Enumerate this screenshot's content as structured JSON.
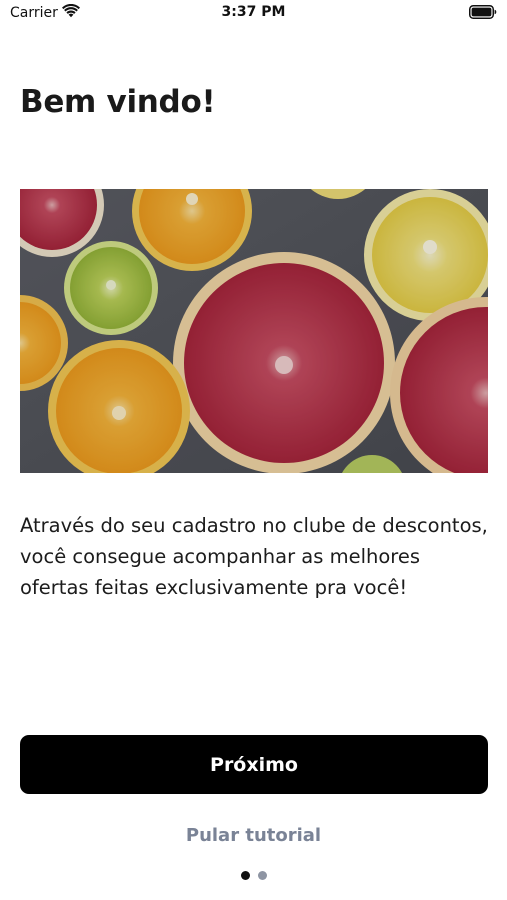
{
  "status_bar": {
    "carrier": "Carrier",
    "time": "3:37 PM",
    "icons": [
      "wifi-icon",
      "battery-icon"
    ]
  },
  "onboarding": {
    "title": "Bem vindo!",
    "image": "citrus-fruit-slices",
    "description": "Através do seu cadastro no clube de descontos, você consegue acompanhar as melhores ofertas feitas exclusivamente pra você!",
    "next_label": "Próximo",
    "skip_label": "Pular tutorial",
    "pages": {
      "total": 2,
      "current": 1
    }
  },
  "colors": {
    "button_background": "#000000",
    "button_text": "#ffffff",
    "skip_text": "#7a8396",
    "dot_active": "#111111",
    "dot_inactive": "#8e95a3"
  }
}
